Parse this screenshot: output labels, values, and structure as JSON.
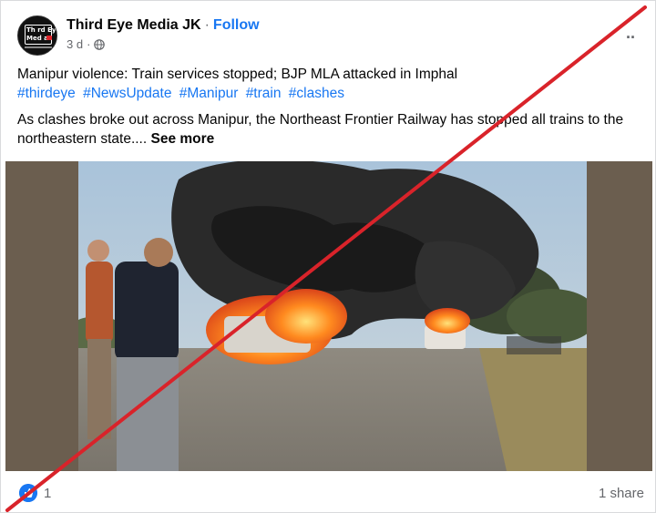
{
  "post": {
    "author": "Third Eye Media JK",
    "separator": "·",
    "follow_label": "Follow",
    "time": "3 d",
    "privacy_icon": "globe-icon",
    "more_icon": "more-options-icon",
    "more_label": "··",
    "avatar_logo": {
      "line1": "Th rd Eye",
      "line2": "Med a"
    },
    "headline": "Manipur violence: Train services stopped; BJP MLA attacked in Imphal",
    "hashtags": [
      "#thirdeye",
      "#NewsUpdate",
      "#Manipur",
      "#train",
      "#clashes"
    ],
    "body": "As clashes broke out across Manipur, the Northeast Frontier Railway has stopped all trains to the northeastern state....",
    "see_more": "See more"
  },
  "footer": {
    "reaction_icon": "like-icon",
    "reaction_count": "1",
    "share_count": "1 share"
  },
  "colors": {
    "link": "#1877f2",
    "secondary_text": "#65676b",
    "cross": "#d9232a"
  }
}
